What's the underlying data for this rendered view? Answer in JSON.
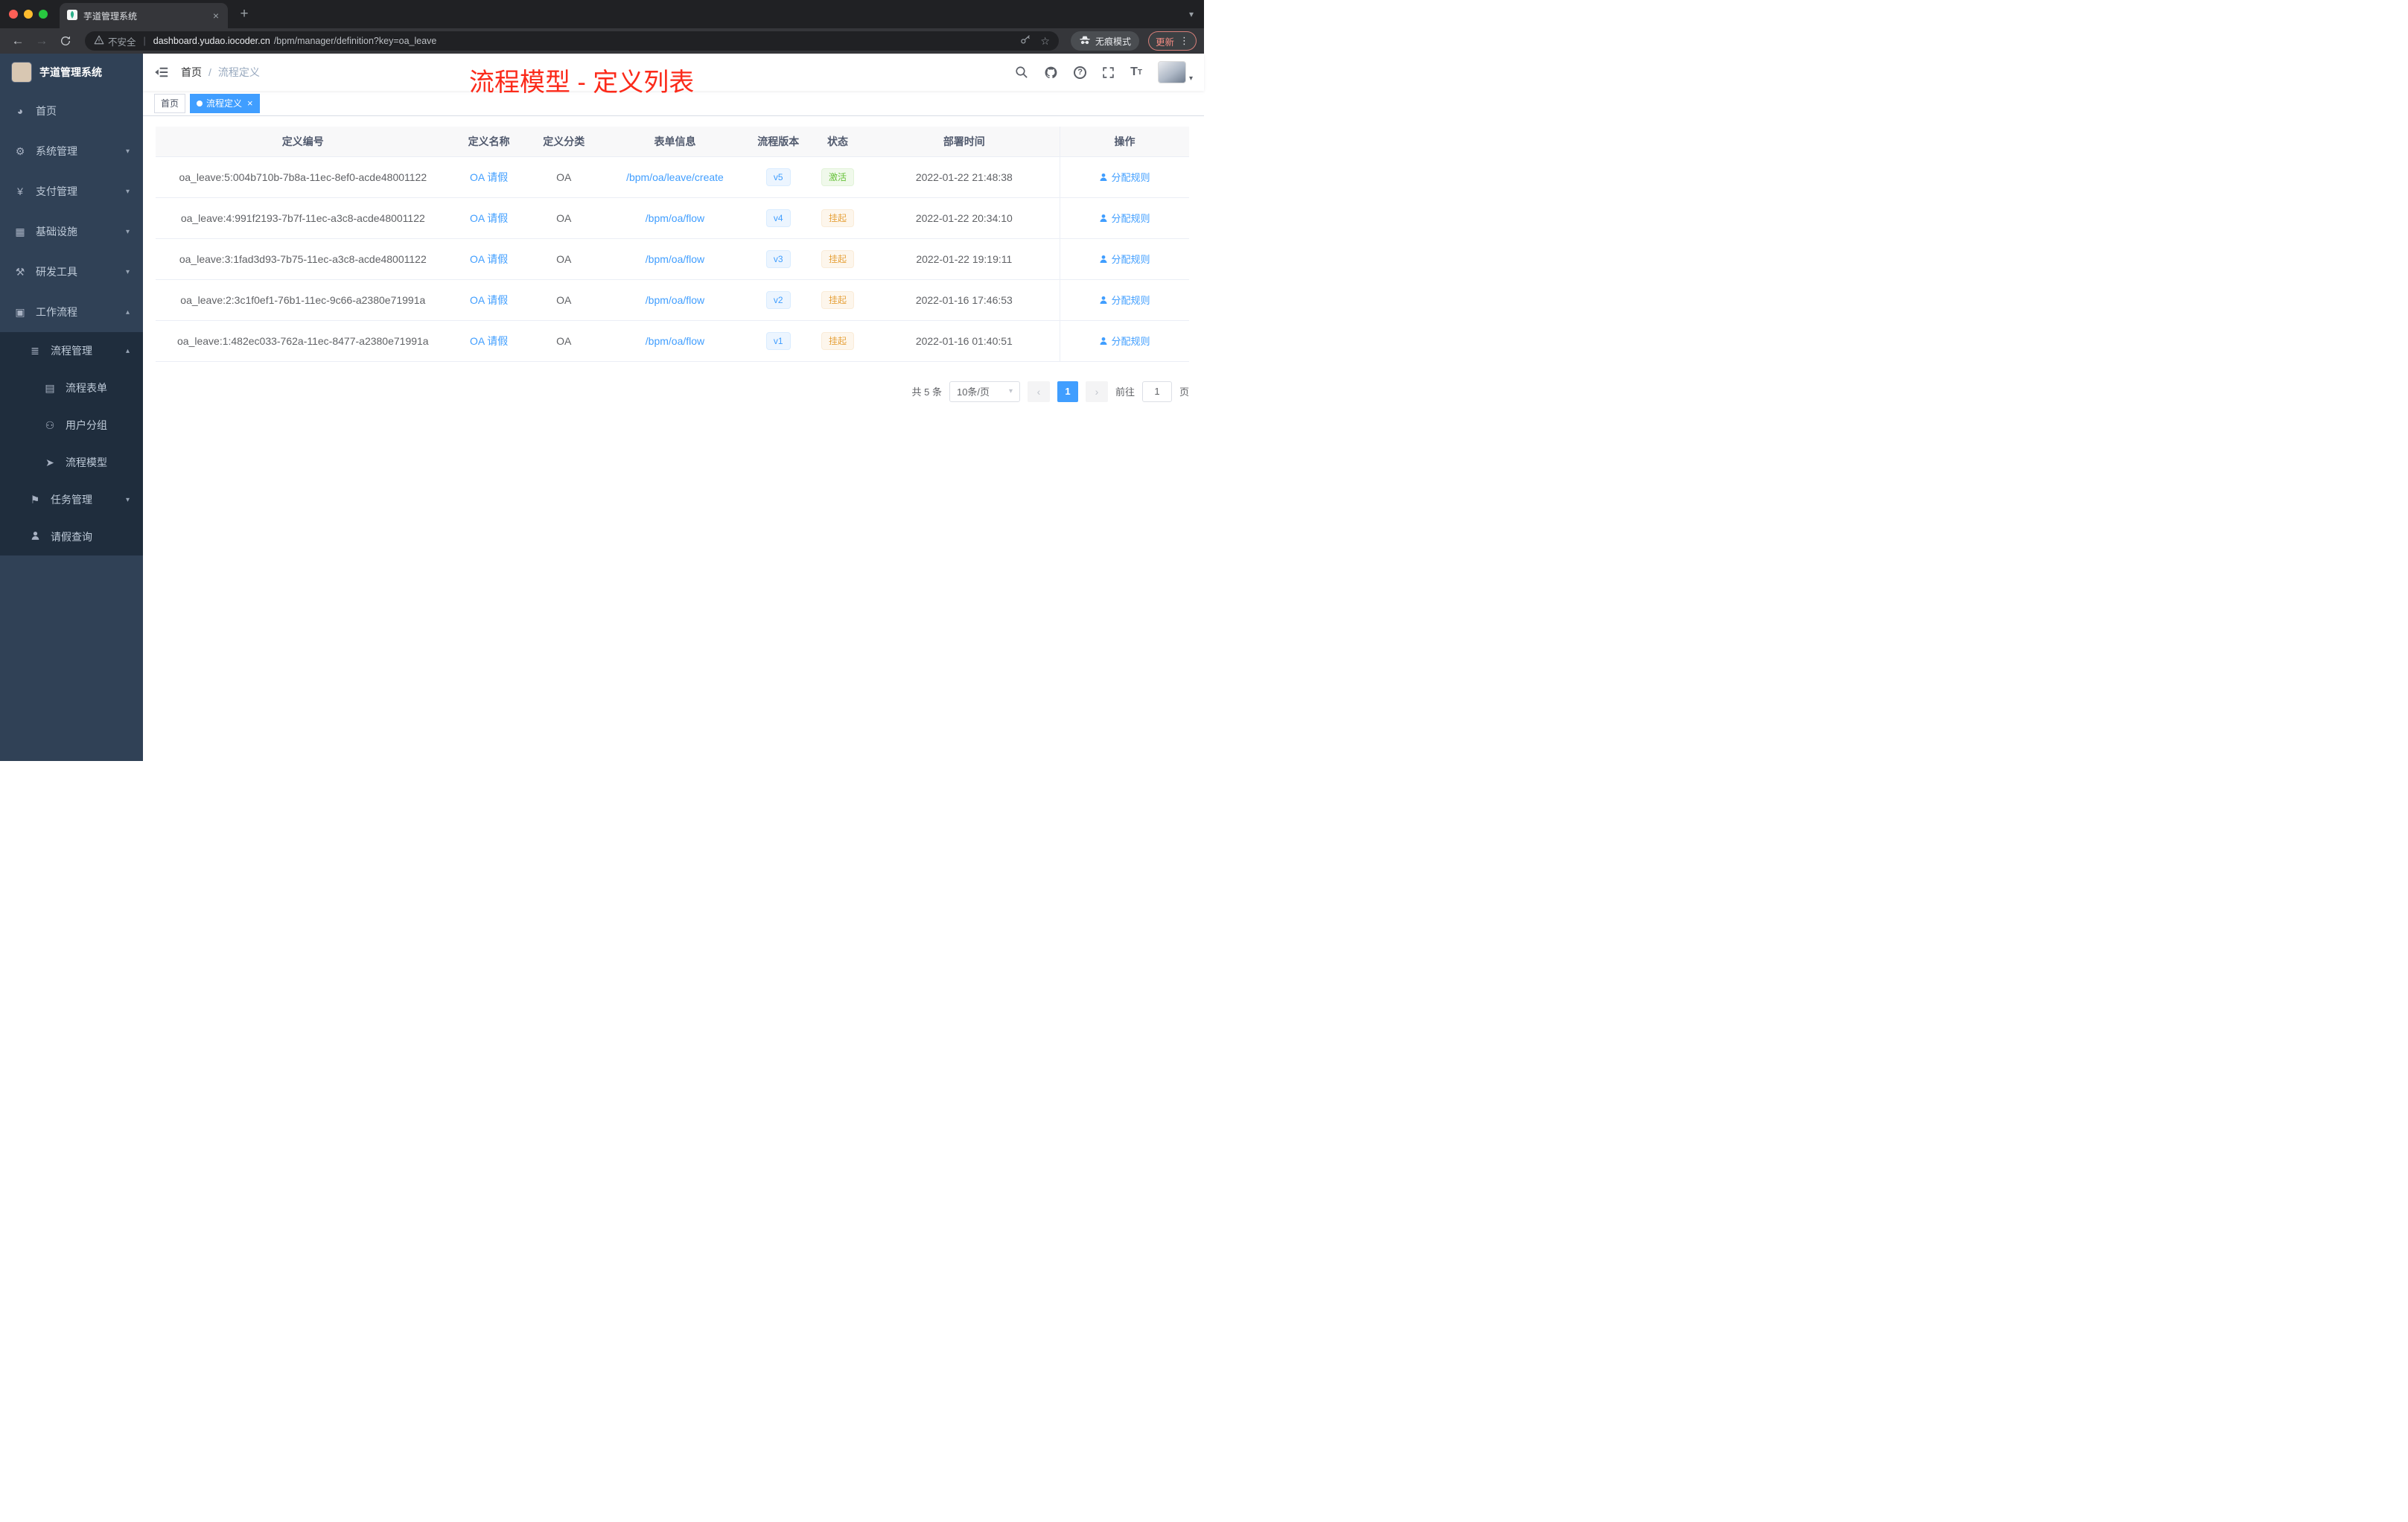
{
  "browser": {
    "tab": {
      "title": "芋道管理系统"
    },
    "security": "不安全",
    "url": {
      "host": "dashboard.yudao.iocoder.cn",
      "path": "/bpm/manager/definition?key=oa_leave"
    },
    "incognito": "无痕模式",
    "update": "更新"
  },
  "icons": {
    "back": "←",
    "forward": "→",
    "plus": "+",
    "close": "×",
    "dots": "⋮",
    "caret_down": "▾",
    "caret_up": "▴",
    "star": "☆",
    "question": "?",
    "divider": "|",
    "prev": "‹",
    "next": "›",
    "font_big": "T",
    "font_small": "T",
    "dashboard": "◕",
    "system": "⚙",
    "pay": "¥",
    "infra": "▦",
    "tools": "⚒",
    "workflow": "▣",
    "process_mgmt": "≣",
    "process_form": "▤",
    "user_group": "⚇",
    "process_model": "➤",
    "task_mgmt": "⚑"
  },
  "colors": {
    "accent": "#409eff",
    "success": "#67c23a",
    "warning": "#e6a23c",
    "sidebar_bg": "#304156",
    "submenu_bg": "#1f2d3d",
    "annotation": "#fb2a1a",
    "traffic_close": "#ff5f57",
    "traffic_min": "#febc2e",
    "traffic_max": "#28c840"
  },
  "sidebar": {
    "logo_title": "芋道管理系统",
    "items": [
      {
        "label": "首页"
      },
      {
        "label": "系统管理"
      },
      {
        "label": "支付管理"
      },
      {
        "label": "基础设施"
      },
      {
        "label": "研发工具"
      },
      {
        "label": "工作流程"
      }
    ],
    "submenu": {
      "process_mgmt": "流程管理",
      "process_form": "流程表单",
      "user_group": "用户分组",
      "process_model": "流程模型",
      "task_mgmt": "任务管理",
      "leave_query": "请假查询"
    }
  },
  "header": {
    "breadcrumb_home": "首页",
    "breadcrumb_sep": "/",
    "breadcrumb_current": "流程定义",
    "annotation": "流程模型 - 定义列表"
  },
  "tags": {
    "home": "首页",
    "current": "流程定义"
  },
  "table": {
    "columns": {
      "id": "定义编号",
      "name": "定义名称",
      "category": "定义分类",
      "form": "表单信息",
      "version": "流程版本",
      "status": "状态",
      "deploy_time": "部署时间",
      "actions": "操作"
    },
    "action_label": "分配规则",
    "rows": [
      {
        "id": "oa_leave:5:004b710b-7b8a-11ec-8ef0-acde48001122",
        "name": "OA 请假",
        "category": "OA",
        "form": "/bpm/oa/leave/create",
        "version": "v5",
        "status": "激活",
        "time": "2022-01-22 21:48:38"
      },
      {
        "id": "oa_leave:4:991f2193-7b7f-11ec-a3c8-acde48001122",
        "name": "OA 请假",
        "category": "OA",
        "form": "/bpm/oa/flow",
        "version": "v4",
        "status": "挂起",
        "time": "2022-01-22 20:34:10"
      },
      {
        "id": "oa_leave:3:1fad3d93-7b75-11ec-a3c8-acde48001122",
        "name": "OA 请假",
        "category": "OA",
        "form": "/bpm/oa/flow",
        "version": "v3",
        "status": "挂起",
        "time": "2022-01-22 19:19:11"
      },
      {
        "id": "oa_leave:2:3c1f0ef1-76b1-11ec-9c66-a2380e71991a",
        "name": "OA 请假",
        "category": "OA",
        "form": "/bpm/oa/flow",
        "version": "v2",
        "status": "挂起",
        "time": "2022-01-16 17:46:53"
      },
      {
        "id": "oa_leave:1:482ec033-762a-11ec-8477-a2380e71991a",
        "name": "OA 请假",
        "category": "OA",
        "form": "/bpm/oa/flow",
        "version": "v1",
        "status": "挂起",
        "time": "2022-01-16 01:40:51"
      }
    ]
  },
  "pagination": {
    "total": "共 5 条",
    "page_size": "10条/页",
    "page": "1",
    "goto_label": "前往",
    "goto_value": "1",
    "goto_unit": "页"
  }
}
